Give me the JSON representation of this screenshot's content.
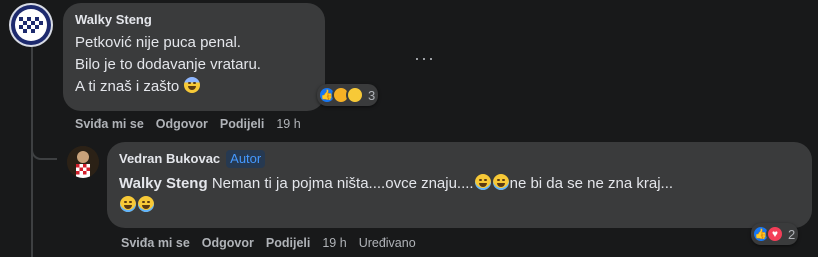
{
  "comment1": {
    "author": "Walky Steng",
    "lines": [
      "Petković nije puca penal.",
      "Bilo je to dodavanje vrataru.",
      "A ti znaš i zašto"
    ],
    "reaction_count": "3",
    "actions": {
      "like": "Sviđa mi se",
      "reply": "Odgovor",
      "share": "Podijeli",
      "time": "19 h"
    },
    "more_icon": "ellipsis-icon"
  },
  "comment2": {
    "author": "Vedran Bukovac",
    "badge": "Autor",
    "mention": "Walky Steng",
    "text_before_emoji": "Neman ti ja pojma ništa....ovce znaju....",
    "text_after_emoji": "ne bi da se ne zna kraj...",
    "reaction_count": "2",
    "actions": {
      "like": "Sviđa mi se",
      "reply": "Odgovor",
      "share": "Podijeli",
      "time": "19 h",
      "edited": "Uređivano"
    }
  },
  "colors": {
    "background": "#18191a",
    "bubble": "#3a3b3c",
    "text": "#e4e6eb",
    "secondary": "#b0b3b8",
    "accent": "#4599ff"
  }
}
